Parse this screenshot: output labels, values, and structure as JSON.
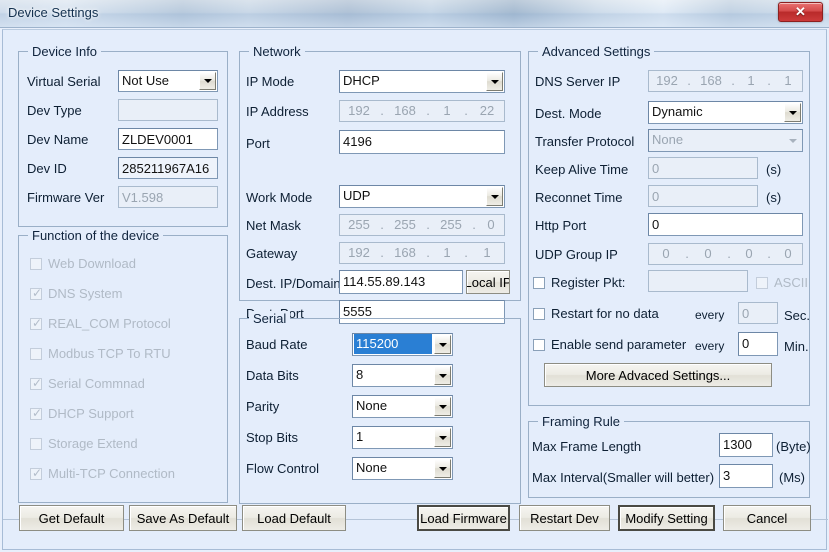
{
  "window": {
    "title": "Device Settings",
    "close_label": "✕"
  },
  "device_info": {
    "legend": "Device Info",
    "rows": [
      {
        "label": "Virtual Serial",
        "value": "Not Use",
        "type": "combo",
        "enabled": true
      },
      {
        "label": "Dev Type",
        "value": "",
        "type": "text",
        "enabled": false
      },
      {
        "label": "Dev Name",
        "value": "ZLDEV0001",
        "type": "text",
        "enabled": true
      },
      {
        "label": "Dev ID",
        "value": "285211967A16",
        "type": "text",
        "enabled": true
      },
      {
        "label": "Firmware Ver",
        "value": "V1.598",
        "type": "text",
        "enabled": false
      }
    ]
  },
  "function_of_device": {
    "legend": "Function of the device",
    "items": [
      {
        "label": "Web Download",
        "checked": false
      },
      {
        "label": "DNS System",
        "checked": true
      },
      {
        "label": "REAL_COM Protocol",
        "checked": true
      },
      {
        "label": "Modbus TCP To RTU",
        "checked": false
      },
      {
        "label": "Serial Commnad",
        "checked": true
      },
      {
        "label": "DHCP Support",
        "checked": true
      },
      {
        "label": "Storage Extend",
        "checked": false
      },
      {
        "label": "Multi-TCP Connection",
        "checked": true
      }
    ]
  },
  "network": {
    "legend": "Network",
    "ip_mode": {
      "label": "IP Mode",
      "value": "DHCP"
    },
    "ip_address": {
      "label": "IP Address",
      "octets": [
        "192",
        "168",
        "1",
        "22"
      ]
    },
    "port": {
      "label": "Port",
      "value": "4196"
    },
    "work_mode": {
      "label": "Work Mode",
      "value": "UDP"
    },
    "net_mask": {
      "label": "Net Mask",
      "octets": [
        "255",
        "255",
        "255",
        "0"
      ]
    },
    "gateway": {
      "label": "Gateway",
      "octets": [
        "192",
        "168",
        "1",
        "1"
      ]
    },
    "dest_ip": {
      "label": "Dest. IP/Domain",
      "value": "114.55.89.143"
    },
    "local_ip_button": "Local IP",
    "dest_port": {
      "label": "Dest. Port",
      "value": "5555"
    }
  },
  "serial": {
    "legend": "Serial",
    "rows": [
      {
        "label": "Baud Rate",
        "value": "115200",
        "selected": true
      },
      {
        "label": "Data Bits",
        "value": "8",
        "selected": false
      },
      {
        "label": "Parity",
        "value": "None",
        "selected": false
      },
      {
        "label": "Stop Bits",
        "value": "1",
        "selected": false
      },
      {
        "label": "Flow Control",
        "value": "None",
        "selected": false
      }
    ]
  },
  "advanced": {
    "legend": "Advanced Settings",
    "dns_server_ip": {
      "label": "DNS Server IP",
      "octets": [
        "192",
        "168",
        "1",
        "1"
      ]
    },
    "dest_mode": {
      "label": "Dest. Mode",
      "value": "Dynamic"
    },
    "transfer_protocol": {
      "label": "Transfer Protocol",
      "value": "None"
    },
    "keep_alive_time": {
      "label": "Keep Alive Time",
      "value": "0",
      "unit": "(s)"
    },
    "reconnet_time": {
      "label": "Reconnet Time",
      "value": "0",
      "unit": "(s)"
    },
    "http_port": {
      "label": "Http Port",
      "value": "0"
    },
    "udp_group_ip": {
      "label": "UDP Group IP",
      "octets": [
        "0",
        "0",
        "0",
        "0"
      ]
    },
    "register_pkt": {
      "label": "Register Pkt:",
      "checked": false,
      "value": ""
    },
    "ascii": {
      "label": "ASCII",
      "checked": false
    },
    "restart_no_data": {
      "label": "Restart for no data",
      "checked": false,
      "every": "every",
      "value": "0",
      "unit": "Sec."
    },
    "enable_send_param": {
      "label": "Enable send parameter",
      "checked": false,
      "every": "every",
      "value": "0",
      "unit": "Min."
    },
    "more_button": "More Advaced Settings..."
  },
  "framing": {
    "legend": "Framing Rule",
    "max_frame_length": {
      "label": "Max Frame Length",
      "value": "1300",
      "unit": "(Byte)"
    },
    "max_interval": {
      "label": "Max Interval(Smaller will better)",
      "value": "3",
      "unit": "(Ms)"
    }
  },
  "buttons": {
    "get_default": "Get Default",
    "save_as_default": "Save As Default",
    "load_default": "Load Default",
    "load_firmware": "Load Firmware",
    "restart_dev": "Restart Dev",
    "modify_setting": "Modify Setting",
    "cancel": "Cancel"
  },
  "colors": {
    "background": "#e4edfb",
    "group_border": "#9aafc7",
    "selection": "#2a7fd4",
    "close_red": "#b92a2a",
    "disabled_text": "#9aa5b1"
  }
}
